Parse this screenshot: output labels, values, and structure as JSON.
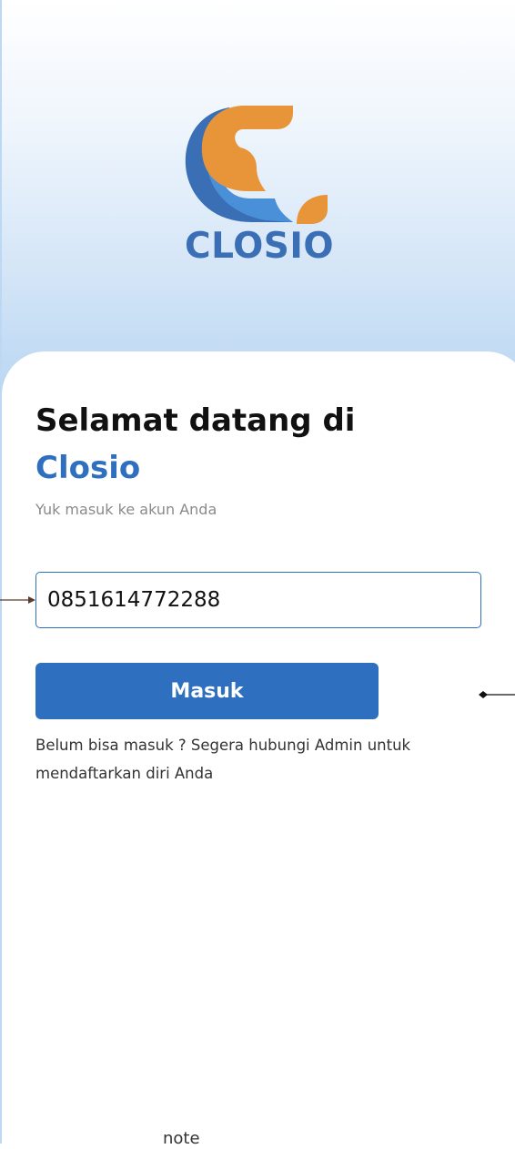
{
  "logo": {
    "text": "CLOSIO",
    "colors": {
      "blue": "#3a6fb5",
      "light_blue": "#4a90d9",
      "orange": "#e8953a"
    }
  },
  "header": {
    "title": "Selamat datang di",
    "brand": "Closio",
    "subtitle": "Yuk masuk ke akun Anda"
  },
  "form": {
    "phone_value": "0851614772288",
    "submit_label": "Masuk"
  },
  "help": {
    "text": "Belum bisa masuk ? Segera hubungi Admin untuk mendaftarkan diri Anda"
  },
  "annotations": {
    "note_label": "note"
  },
  "theme": {
    "primary": "#2f6fbf",
    "background_gradient_end": "#bcd8f3"
  }
}
